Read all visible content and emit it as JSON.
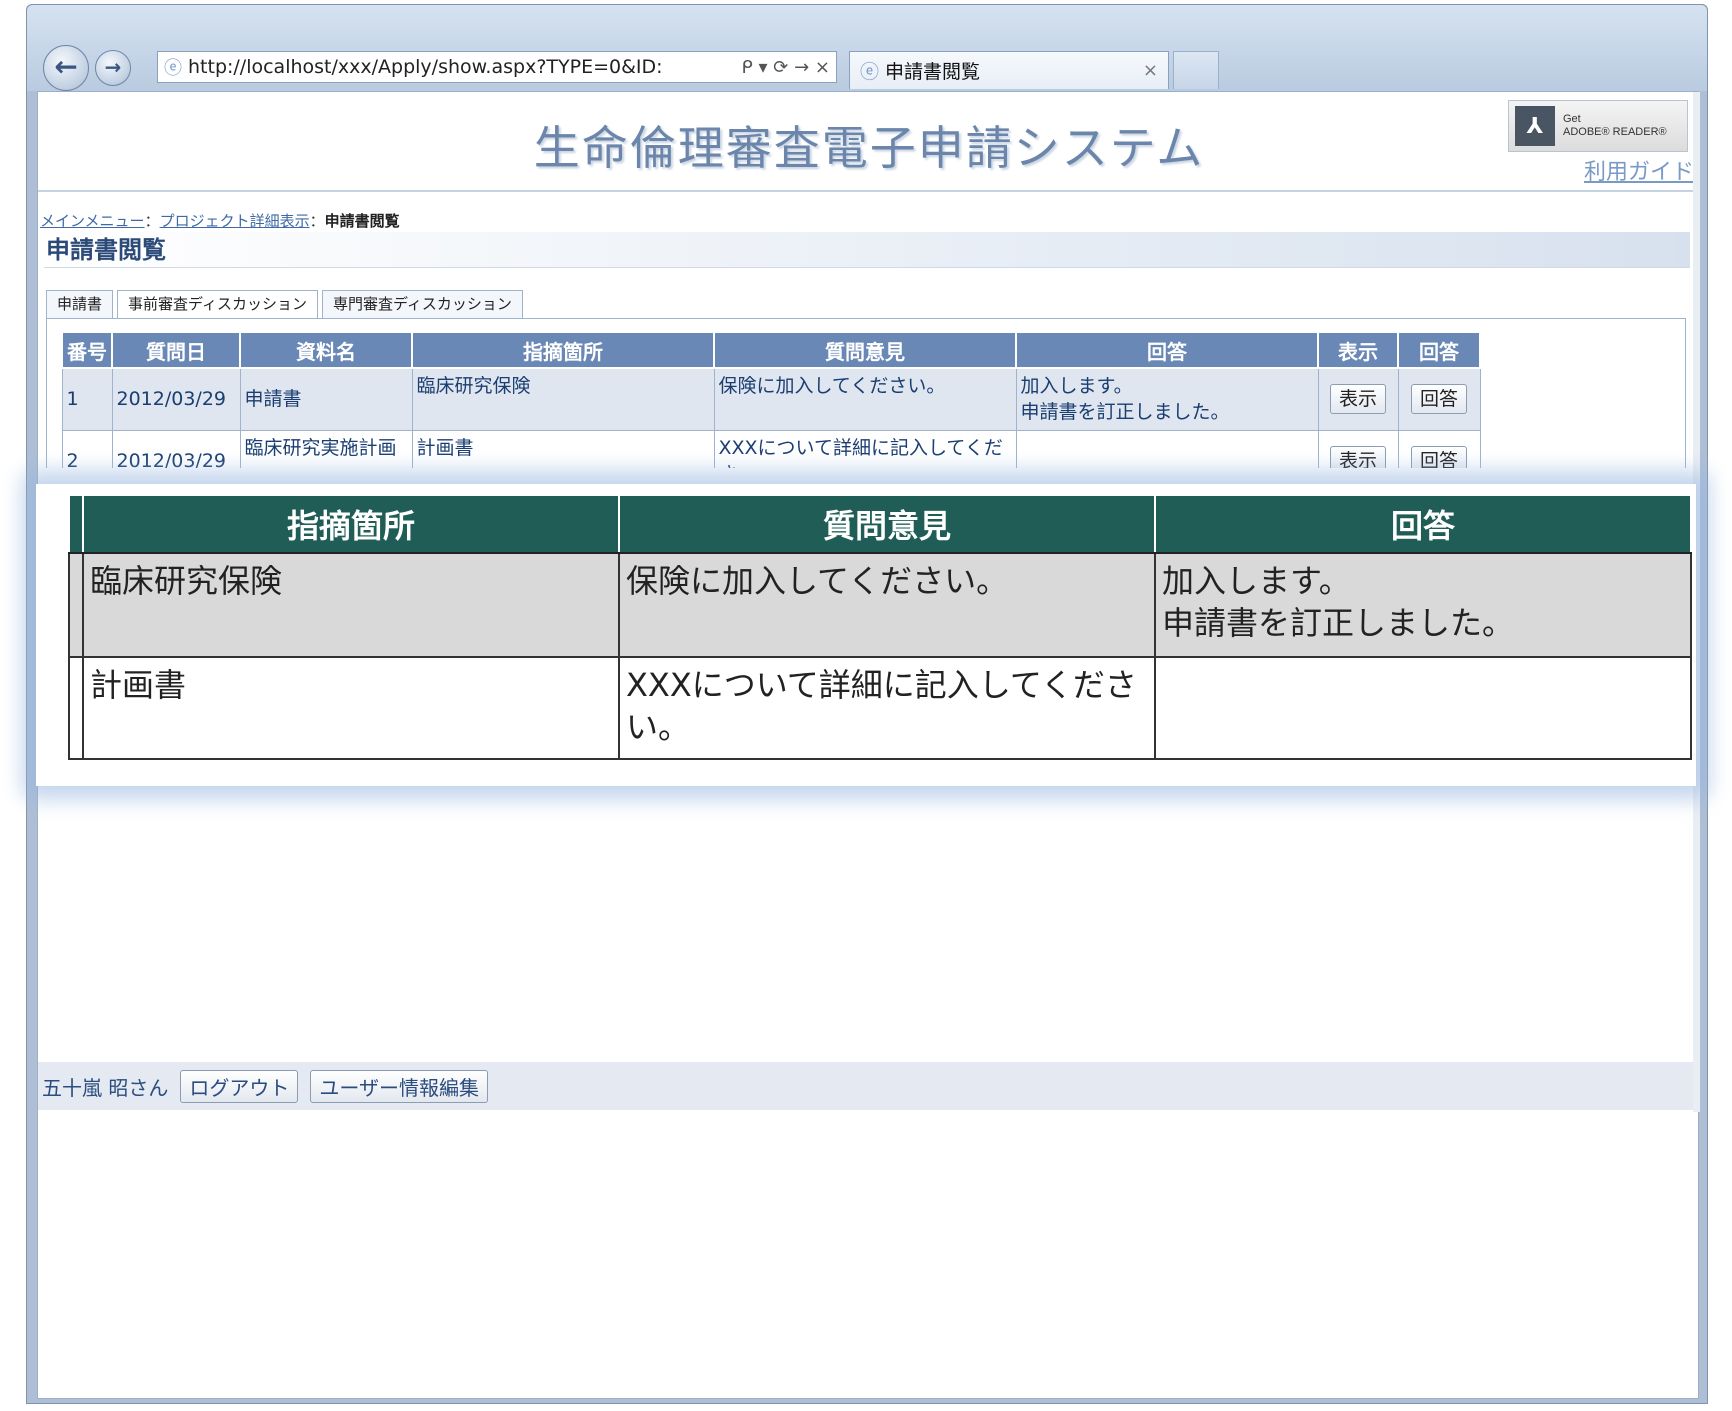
{
  "browser": {
    "url": "http://localhost/xxx/Apply/show.aspx?TYPE=0&ID:",
    "tab_title": "申請書閲覧",
    "tab_close": "×",
    "back_icon": "←",
    "forward_icon": "→",
    "address_tools": "ᑭ ▾ ⟳ → ×"
  },
  "header": {
    "app_title": "生命倫理審査電子申請システム",
    "adobe_get": "Get",
    "adobe_reader": "ADOBE® READER®",
    "guide_link": "利用ガイド"
  },
  "breadcrumb": {
    "main_menu": "メインメニュー",
    "separator1": "：",
    "project_detail": "プロジェクト詳細表示",
    "separator2": "：",
    "current": "申請書閲覧"
  },
  "section_heading": "申請書閲覧",
  "tabs": [
    {
      "label": "申請書"
    },
    {
      "label": "事前審査ディスカッション"
    },
    {
      "label": "専門審査ディスカッション"
    }
  ],
  "question_table": {
    "headers": [
      "番号",
      "質問日",
      "資料名",
      "指摘箇所",
      "質問意見",
      "回答",
      "表示",
      "回答"
    ],
    "rows": [
      {
        "no": "1",
        "date": "2012/03/29",
        "doc": "申請書",
        "location": "臨床研究保険",
        "question": "保険に加入してください。",
        "answer_line1": "加入します。",
        "answer_line2": "申請書を訂正しました。",
        "show_btn": "表示",
        "answer_btn": "回答"
      },
      {
        "no": "2",
        "date": "2012/03/29",
        "doc": "臨床研究実施計画",
        "location": "計画書",
        "question": "XXXについて詳細に記入してくださ",
        "answer_line1": "",
        "answer_line2": "",
        "show_btn": "表示",
        "answer_btn": "回答"
      }
    ]
  },
  "zoom_table": {
    "headers": [
      "指摘箇所",
      "質問意見",
      "回答"
    ],
    "rows": [
      {
        "location": "臨床研究保険",
        "question": "保険に加入してください。",
        "answer_line1": "加入します。",
        "answer_line2": "申請書を訂正しました。"
      },
      {
        "location": "計画書",
        "question": "XXXについて詳細に記入してくださ",
        "question_line2": "い。",
        "answer_line1": "",
        "answer_line2": ""
      }
    ]
  },
  "footer": {
    "user": "五十嵐 昭さん",
    "logout": "ログアウト",
    "edit_user": "ユーザー情報編集"
  }
}
